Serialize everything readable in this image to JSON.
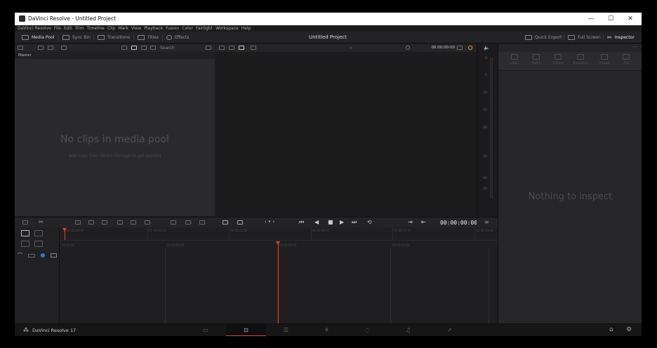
{
  "window": {
    "title": "DaVinci Resolve - Untitled Project",
    "min_glyph": "—",
    "max_glyph": "☐",
    "close_glyph": "✕"
  },
  "menu": [
    "DaVinci Resolve",
    "File",
    "Edit",
    "Trim",
    "Timeline",
    "Clip",
    "Mark",
    "View",
    "Playback",
    "Fusion",
    "Color",
    "Fairlight",
    "Workspace",
    "Help"
  ],
  "toolbar": {
    "media_pool": "Media Pool",
    "sync_bin": "Sync Bin",
    "transitions": "Transitions",
    "titles": "Titles",
    "effects": "Effects",
    "project_title": "Untitled Project",
    "quick_export": "Quick Export",
    "full_screen": "Full Screen",
    "inspector": "Inspector"
  },
  "media_pool": {
    "search_placeholder": "Search",
    "bin": "Master",
    "empty_title": "No clips in media pool",
    "empty_hint": "Add clips from Media Storage to get started"
  },
  "viewer": {
    "timecode": "00:00:00:00",
    "zoom_glyph": "⌄"
  },
  "meters": {
    "db_labels": [
      "0",
      "-5",
      "-10",
      "-15",
      "-20",
      "-30",
      "-40",
      "-50"
    ]
  },
  "inspector": {
    "tabs": [
      "Video",
      "Audio",
      "Effects",
      "Transition",
      "Image",
      "File"
    ],
    "empty": "Nothing to inspect"
  },
  "transport": {
    "timecode": "00:00:00:00",
    "jog": "‹ • ›"
  },
  "timeline": {
    "ruler_top": [
      "00:00:00:00",
      "01:00:03:02",
      "01:00:05:16",
      "01:00:08:05",
      "01:00:10:19",
      "01:00:13:08"
    ],
    "ruler_bottom": [
      "00:00:00",
      "00:00:04:00",
      "00:00:08:00",
      "00:00:12:00"
    ]
  },
  "bottom": {
    "brand": "DaVinci Resolve 17",
    "home_glyph": "⌂",
    "settings_glyph": "⚙"
  },
  "colors": {
    "accent": "#d0463b",
    "panel": "#2a2a2c",
    "background": "#1c1c1e"
  }
}
